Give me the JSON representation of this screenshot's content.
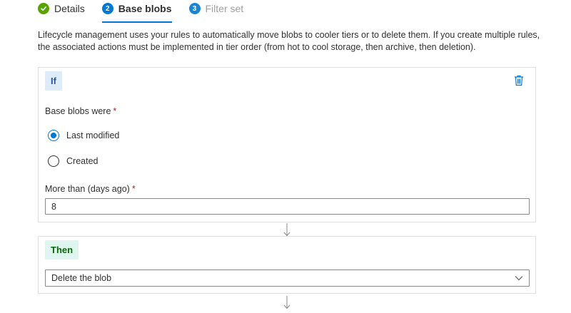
{
  "tabs": [
    {
      "number": "",
      "label": "Details",
      "state": "done"
    },
    {
      "number": "2",
      "label": "Base blobs",
      "state": "active"
    },
    {
      "number": "3",
      "label": "Filter set",
      "state": "disabled"
    }
  ],
  "description": "Lifecycle management uses your rules to automatically move blobs to cooler tiers or to delete them. If you create multiple rules, the associated actions must be implemented in tier order (from hot to cool storage, then archive, then deletion).",
  "if_card": {
    "chip": "If",
    "delete_icon": "trash-icon",
    "base_blobs_label": "Base blobs were",
    "required_marker": "*",
    "options": [
      {
        "label": "Last modified",
        "checked": true
      },
      {
        "label": "Created",
        "checked": false
      }
    ],
    "days_label": "More than (days ago)",
    "days_value": "8"
  },
  "then_card": {
    "chip": "Then",
    "action_value": "Delete the blob"
  },
  "colors": {
    "accent": "#0078d4",
    "success": "#57a300",
    "if_chip_bg": "#deecf9",
    "then_chip_bg": "#dff6f0"
  }
}
